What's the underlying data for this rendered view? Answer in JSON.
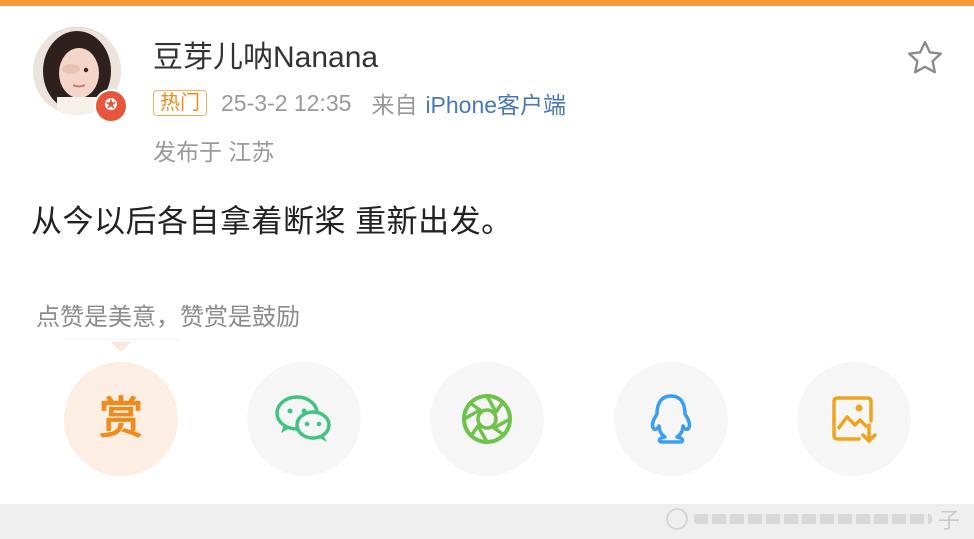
{
  "post": {
    "username": "豆芽儿呐Nanana",
    "hot_badge": "热门",
    "time": "25-3-2 12:35",
    "from_label": "来自",
    "client": "iPhone客户端",
    "location": "发布于 江苏",
    "text": "从今以后各自拿着断桨 重新出发。"
  },
  "reward": {
    "tip": "点赞是美意，赞赏是鼓励",
    "button_char": "赏"
  },
  "share_icons": [
    "reward-icon",
    "wechat-icon",
    "moments-icon",
    "qq-icon",
    "save-image-icon"
  ],
  "watermark": {
    "trail_char": "子"
  },
  "colors": {
    "accent_orange": "#f08a1a",
    "link_blue": "#4a78b5",
    "wechat_green": "#3fc57f",
    "moments_green": "#6fc24b",
    "qq_blue": "#3a9ff0",
    "save_orange": "#f2a31d"
  }
}
